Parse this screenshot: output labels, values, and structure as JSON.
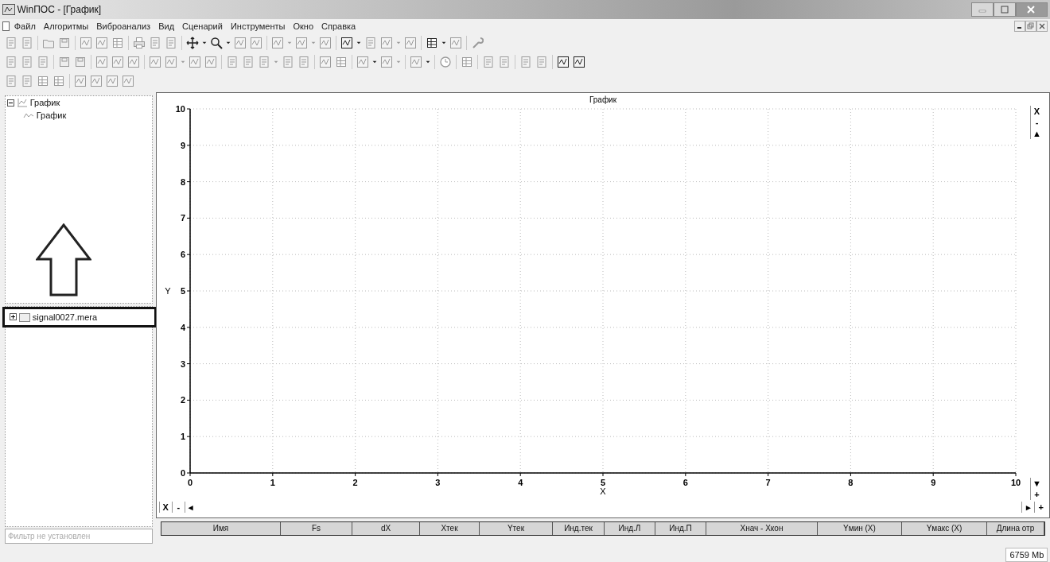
{
  "window": {
    "title": "WinПОС - [График]"
  },
  "menu": [
    "Файл",
    "Алгоритмы",
    "Виброанализ",
    "Вид",
    "Сценарий",
    "Инструменты",
    "Окно",
    "Справка"
  ],
  "tree": [
    {
      "label": "График",
      "expanded": true,
      "children": [
        {
          "label": "График"
        }
      ]
    }
  ],
  "files": [
    {
      "label": "signal0027.mera",
      "expanded": false,
      "framed": true
    }
  ],
  "filter": {
    "placeholder": "Фильтр не установлен"
  },
  "chart": {
    "chart_data": {
      "type": "line",
      "grid": true,
      "title": "График",
      "xlabel": "X",
      "ylabel": "Y",
      "xlim": [
        0,
        10
      ],
      "ylim": [
        0,
        10
      ],
      "xticks": [
        0,
        1,
        2,
        3,
        4,
        5,
        6,
        7,
        8,
        9,
        10
      ],
      "yticks": [
        0,
        1,
        2,
        3,
        4,
        5,
        6,
        7,
        8,
        9,
        10
      ]
    },
    "y_scroll": {
      "top": [
        "X",
        "-",
        "▲"
      ],
      "bottom": [
        "▼",
        "+"
      ]
    },
    "x_scroll": {
      "left": [
        "X",
        "-",
        "◂"
      ],
      "right": [
        "▸",
        "+"
      ]
    }
  },
  "table": {
    "columns": [
      "Имя",
      "Fs",
      "dX",
      "Xтек",
      "Yтек",
      "Инд.тек",
      "Инд.Л",
      "Инд.П",
      "Xнач - Xкон",
      "Yмин (X)",
      "Yмакс (X)",
      "Длина отр"
    ]
  },
  "status_bar": {
    "memory": "6759 Mb"
  }
}
